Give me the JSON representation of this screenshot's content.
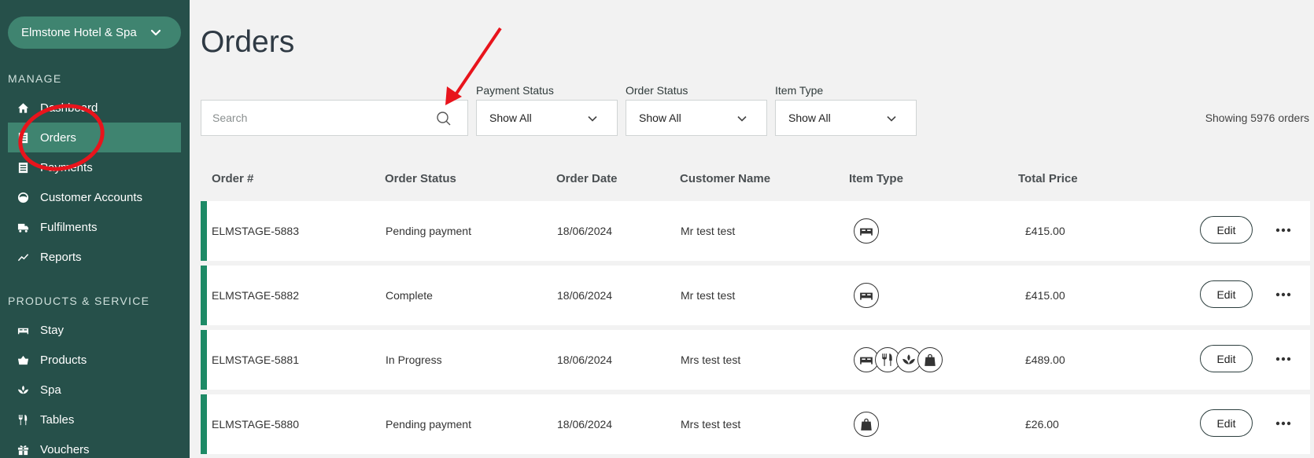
{
  "sidebar": {
    "hotel": "Elmstone Hotel & Spa",
    "manage_label": "MANAGE",
    "manage_items": [
      {
        "label": "Dashboard",
        "icon": "home-icon"
      },
      {
        "label": "Orders",
        "icon": "list-icon",
        "active": true
      },
      {
        "label": "Payments",
        "icon": "list-icon"
      },
      {
        "label": "Customer Accounts",
        "icon": "user-circle-icon"
      },
      {
        "label": "Fulfilments",
        "icon": "truck-icon"
      },
      {
        "label": "Reports",
        "icon": "chart-line-icon"
      }
    ],
    "products_label": "PRODUCTS & SERVICE",
    "product_items": [
      {
        "label": "Stay",
        "icon": "bed-icon"
      },
      {
        "label": "Products",
        "icon": "basket-icon"
      },
      {
        "label": "Spa",
        "icon": "lotus-icon"
      },
      {
        "label": "Tables",
        "icon": "cutlery-icon"
      },
      {
        "label": "Vouchers",
        "icon": "gift-icon"
      }
    ]
  },
  "main": {
    "title": "Orders",
    "search_placeholder": "Search",
    "filters": {
      "payment_status": {
        "label": "Payment Status",
        "value": "Show All"
      },
      "order_status": {
        "label": "Order Status",
        "value": "Show All"
      },
      "item_type": {
        "label": "Item Type",
        "value": "Show All"
      }
    },
    "showing": "Showing 5976 orders",
    "columns": [
      "Order #",
      "Order Status",
      "Order Date",
      "Customer Name",
      "Item Type",
      "Total Price"
    ],
    "edit_label": "Edit",
    "rows": [
      {
        "order": "ELMSTAGE-5883",
        "status": "Pending payment",
        "date": "18/06/2024",
        "customer": "Mr test test",
        "types": [
          "bed-icon"
        ],
        "price": "£415.00"
      },
      {
        "order": "ELMSTAGE-5882",
        "status": "Complete",
        "date": "18/06/2024",
        "customer": "Mr test test",
        "types": [
          "bed-icon"
        ],
        "price": "£415.00"
      },
      {
        "order": "ELMSTAGE-5881",
        "status": "In Progress",
        "date": "18/06/2024",
        "customer": "Mrs test test",
        "types": [
          "bed-icon",
          "cutlery-icon",
          "lotus-icon",
          "bag-icon"
        ],
        "price": "£489.00"
      },
      {
        "order": "ELMSTAGE-5880",
        "status": "Pending payment",
        "date": "18/06/2024",
        "customer": "Mrs test test",
        "types": [
          "bag-icon"
        ],
        "price": "£26.00"
      }
    ]
  },
  "colors": {
    "sidebar_bg": "#26504a",
    "sidebar_active": "#3f8470",
    "row_accent": "#1d8a66",
    "annotation": "#e8141c"
  }
}
